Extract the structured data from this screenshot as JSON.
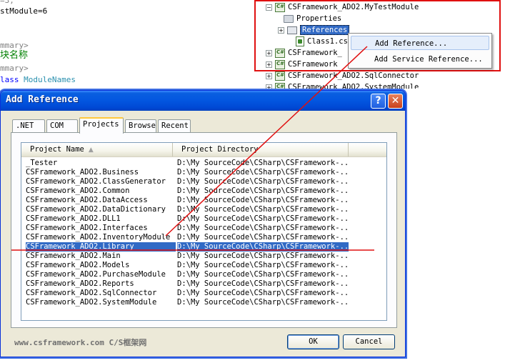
{
  "editor": {
    "lines": [
      {
        "text": "=3;",
        "cls": "c-gray"
      },
      {
        "text": "stModule=6",
        "cls": ""
      },
      {
        "text": "",
        "cls": ""
      },
      {
        "text": "mmary>",
        "cls": "c-gray"
      },
      {
        "text": "块名称",
        "cls": "c-green"
      },
      {
        "text": "mmary>",
        "cls": "c-gray"
      },
      {
        "text": "lass",
        "cls": "c-blue",
        "after": " ModuleNames",
        "after_cls": "c-teal"
      }
    ]
  },
  "solution_explorer": {
    "items": [
      {
        "label": "CSFramework_ADO2.MyTestModule",
        "icon": "project-icon",
        "expander": "minus",
        "indent": 0
      },
      {
        "label": "Properties",
        "icon": "properties-folder-icon",
        "expander": "none",
        "indent": 1
      },
      {
        "label": "References",
        "icon": "references-icon",
        "expander": "plus",
        "indent": 1,
        "selected": true
      },
      {
        "label": "Class1.cs",
        "icon": "csharp-file-icon",
        "expander": "none",
        "indent": 1
      },
      {
        "label": "CSFramework_",
        "icon": "project-icon",
        "expander": "plus",
        "indent": 0
      },
      {
        "label": "CSFramework",
        "icon": "project-icon",
        "expander": "plus",
        "indent": 0
      },
      {
        "label": "CSFramework_ADO2.SqlConnector",
        "icon": "project-icon",
        "expander": "plus",
        "indent": 0
      },
      {
        "label": "CSFramework_ADO2.SystemModule",
        "icon": "project-icon",
        "expander": "plus",
        "indent": 0
      }
    ]
  },
  "context_menu": {
    "items": [
      {
        "label": "Add Reference...",
        "hover": true
      },
      {
        "label": "Add Service Reference...",
        "hover": false
      }
    ]
  },
  "dialog": {
    "title": "Add Reference",
    "help_label": "?",
    "close_label": "✕",
    "tabs": [
      {
        "label": ".NET",
        "active": false
      },
      {
        "label": "COM",
        "active": false
      },
      {
        "label": "Projects",
        "active": true
      },
      {
        "label": "Browse",
        "active": false
      },
      {
        "label": "Recent",
        "active": false
      }
    ],
    "columns": [
      "Project Name",
      "Project Directory"
    ],
    "sort_indicator": "▲",
    "rows": [
      {
        "name": "_Tester",
        "dir": "D:\\My SourceCode\\CSharp\\CSFramework-..."
      },
      {
        "name": "CSFramework_ADO2.Business",
        "dir": "D:\\My SourceCode\\CSharp\\CSFramework-..."
      },
      {
        "name": "CSFramework_ADO2.ClassGenerator",
        "dir": "D:\\My SourceCode\\CSharp\\CSFramework-..."
      },
      {
        "name": "CSFramework_ADO2.Common",
        "dir": "D:\\My SourceCode\\CSharp\\CSFramework-..."
      },
      {
        "name": "CSFramework_ADO2.DataAccess",
        "dir": "D:\\My SourceCode\\CSharp\\CSFramework-..."
      },
      {
        "name": "CSFramework_ADO2.DataDictionary",
        "dir": "D:\\My SourceCode\\CSharp\\CSFramework-..."
      },
      {
        "name": "CSFramework_ADO2.DLL1",
        "dir": "D:\\My SourceCode\\CSharp\\CSFramework-..."
      },
      {
        "name": "CSFramework_ADO2.Interfaces",
        "dir": "D:\\My SourceCode\\CSharp\\CSFramework-..."
      },
      {
        "name": "CSFramework_ADO2.InventoryModule",
        "dir": "D:\\My SourceCode\\CSharp\\CSFramework-..."
      },
      {
        "name": "CSFramework_ADO2.Library",
        "dir": "D:\\My SourceCode\\CSharp\\CSFramework-...",
        "selected": true
      },
      {
        "name": "CSFramework_ADO2.Main",
        "dir": "D:\\My SourceCode\\CSharp\\CSFramework-..."
      },
      {
        "name": "CSFramework_ADO2.Models",
        "dir": "D:\\My SourceCode\\CSharp\\CSFramework-..."
      },
      {
        "name": "CSFramework_ADO2.PurchaseModule",
        "dir": "D:\\My SourceCode\\CSharp\\CSFramework-..."
      },
      {
        "name": "CSFramework_ADO2.Reports",
        "dir": "D:\\My SourceCode\\CSharp\\CSFramework-..."
      },
      {
        "name": "CSFramework_ADO2.SqlConnector",
        "dir": "D:\\My SourceCode\\CSharp\\CSFramework-..."
      },
      {
        "name": "CSFramework_ADO2.SystemModule",
        "dir": "D:\\My SourceCode\\CSharp\\CSFramework-..."
      }
    ],
    "watermark": "www.csframework.com C/S框架网",
    "ok_label": "OK",
    "cancel_label": "Cancel"
  },
  "annotation_color": "#e01010"
}
